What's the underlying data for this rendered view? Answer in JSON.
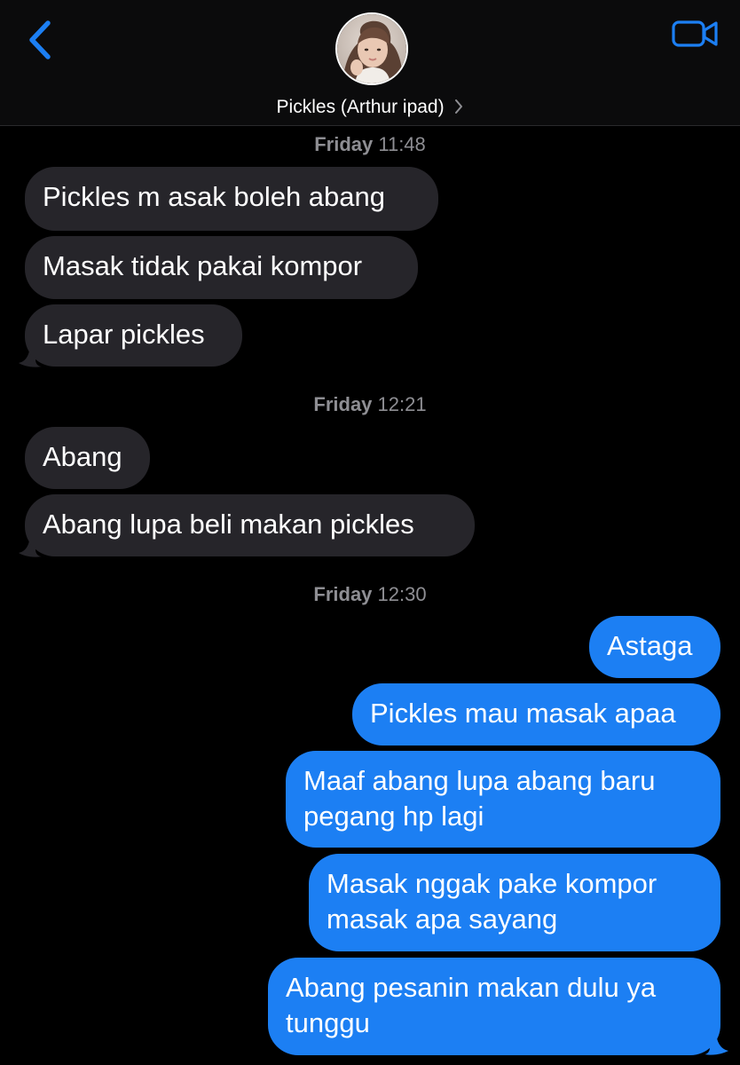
{
  "header": {
    "contact_name": "Pickles (Arthur ipad)",
    "back_icon": "chevron-left-icon",
    "video_icon": "video-camera-icon",
    "accent_color": "#1c7ff3"
  },
  "conversation": [
    {
      "type": "timestamp",
      "day": "Friday",
      "time": "11:48"
    },
    {
      "type": "incoming",
      "text": "Pickles m asak boleh abang"
    },
    {
      "type": "incoming",
      "text": "Masak tidak pakai kompor"
    },
    {
      "type": "incoming",
      "text": "Lapar pickles"
    },
    {
      "type": "timestamp",
      "day": "Friday",
      "time": "12:21"
    },
    {
      "type": "incoming",
      "text": "Abang"
    },
    {
      "type": "incoming",
      "text": "Abang lupa beli makan pickles"
    },
    {
      "type": "timestamp",
      "day": "Friday",
      "time": "12:30"
    },
    {
      "type": "outgoing",
      "text": "Astaga"
    },
    {
      "type": "outgoing",
      "text": "Pickles mau masak apaa"
    },
    {
      "type": "outgoing",
      "line1": "Maaf abang lupa abang baru",
      "line2": "pegang hp lagi"
    },
    {
      "type": "outgoing",
      "line1": "Masak nggak pake kompor",
      "line2": "masak apa sayang"
    },
    {
      "type": "outgoing",
      "line1": "Abang pesanin makan dulu ya",
      "line2": "tunggu"
    }
  ],
  "colors": {
    "incoming_bubble": "#26252a",
    "outgoing_bubble": "#1c7ff3",
    "timestamp_text": "#8e8e93",
    "background": "#000000"
  }
}
